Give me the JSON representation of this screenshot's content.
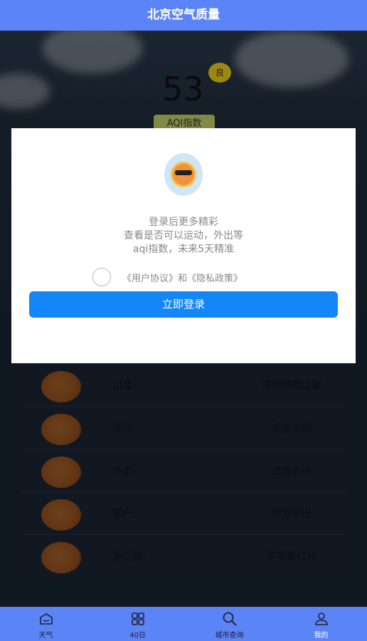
{
  "header": {
    "title": "北京空气质量"
  },
  "background": {
    "aqi_value": "53",
    "aqi_badge": "良",
    "aqi_tag": "AQI指数",
    "advice_rows": [
      {
        "label": "口罩:",
        "value": "不用佩戴口罩"
      },
      {
        "label": "运动:",
        "value": "适宜运动"
      },
      {
        "label": "外出:",
        "value": "适宜外出"
      },
      {
        "label": "室户:",
        "value": "适宜外出"
      },
      {
        "label": "净化器:",
        "value": "不需要打开"
      }
    ]
  },
  "modal": {
    "line1": "登录后更多精彩",
    "line2": "查看是否可以运动，外出等",
    "line3": "aqi指数，未来5天精准",
    "agree_text": "《用户协议》和《隐私政策》",
    "login_button": "立即登录"
  },
  "tabbar": {
    "items": [
      {
        "label": "天气",
        "icon": "house-icon"
      },
      {
        "label": "40日",
        "icon": "grid-icon"
      },
      {
        "label": "城市查询",
        "icon": "search-icon"
      },
      {
        "label": "我的",
        "icon": "user-icon"
      }
    ],
    "active_index": 3
  },
  "colors": {
    "accent": "#5b84f7",
    "button": "#1387f7"
  }
}
